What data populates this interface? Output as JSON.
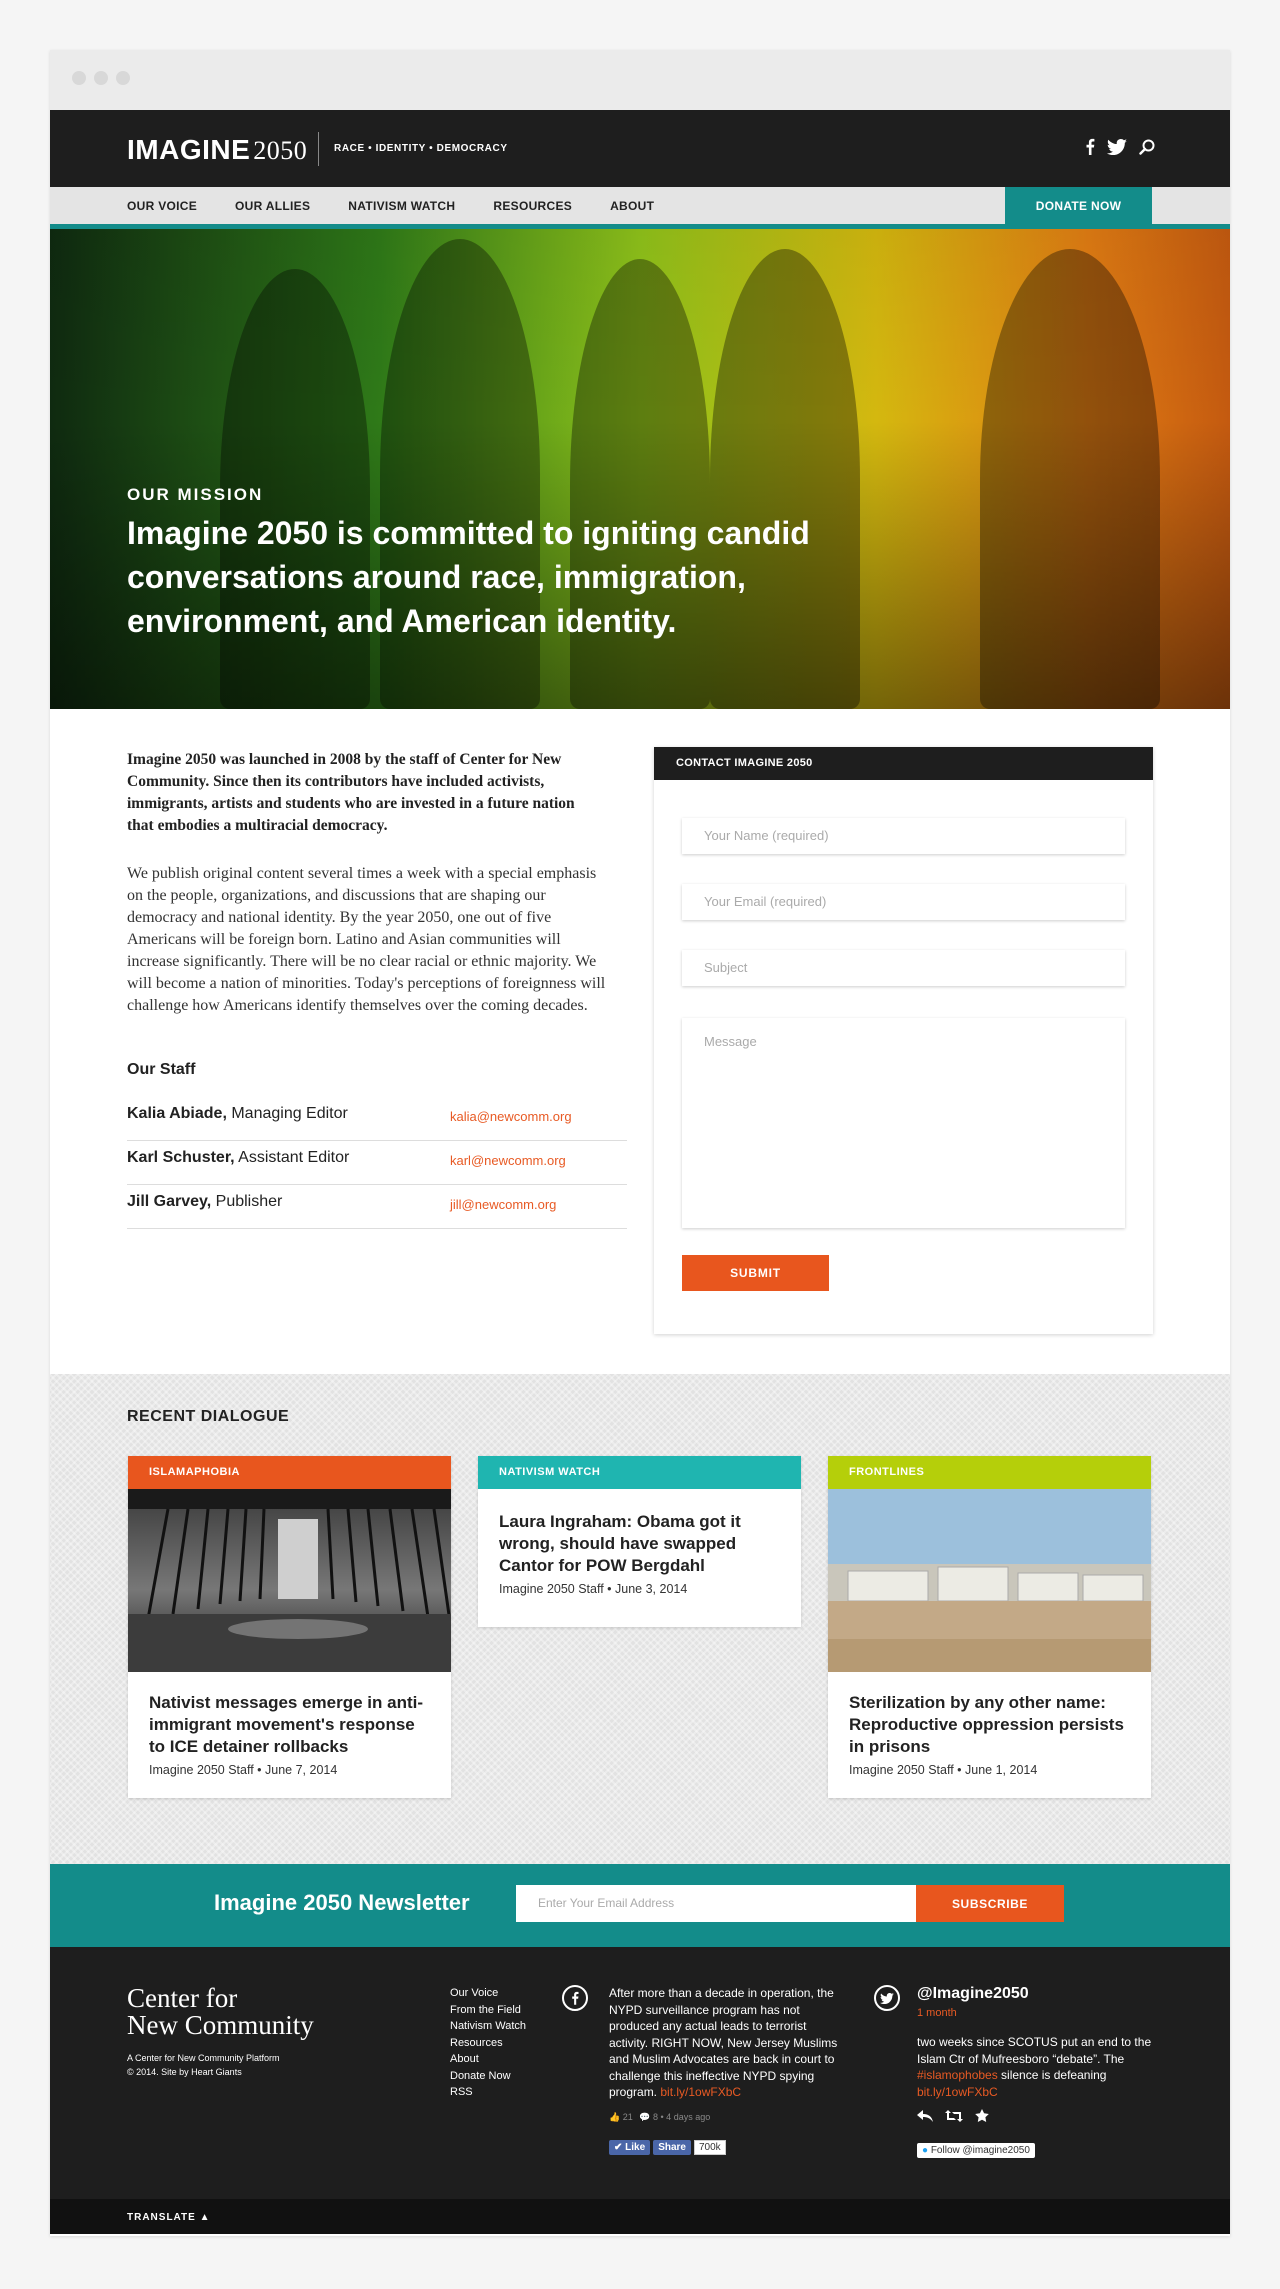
{
  "header": {
    "logo": "IMAGINE",
    "logo_year": "2050",
    "tagline": "RACE • IDENTITY • DEMOCRACY",
    "social_icons": [
      "facebook-icon",
      "twitter-icon",
      "search-icon"
    ]
  },
  "nav": {
    "items": [
      "OUR VOICE",
      "OUR ALLIES",
      "NATIVISM WATCH",
      "RESOURCES",
      "ABOUT"
    ],
    "donate": "DONATE NOW"
  },
  "hero": {
    "label": "OUR MISSION",
    "text": "Imagine 2050 is committed to igniting candid conversations around race, immigration, environment, and American identity."
  },
  "intro": {
    "bold": "Imagine 2050 was launched in 2008 by the staff of Center for New Community. Since then its contributors have included activists, immigrants, artists and students who are invested in a future nation that embodies a multiracial democracy.",
    "body": "We publish original content several times a week with a special emphasis on the people, organizations, and discussions that are shaping our democracy and national identity. By the year 2050, one out of five Americans will be foreign born. Latino and Asian communities will increase significantly. There will be no clear racial or ethnic majority. We will become a nation of minorities. Today's perceptions of foreignness will challenge how Americans identify themselves over the coming decades."
  },
  "staff": {
    "title": "Our Staff",
    "members": [
      {
        "name": "Kalia Abiade,",
        "role": " Managing Editor",
        "email": "kalia@newcomm.org"
      },
      {
        "name": "Karl Schuster,",
        "role": " Assistant Editor",
        "email": "karl@newcomm.org"
      },
      {
        "name": "Jill Garvey,",
        "role": " Publisher",
        "email": "jill@newcomm.org"
      }
    ]
  },
  "contact": {
    "title": "CONTACT IMAGINE 2050",
    "name_placeholder": "Your Name (required)",
    "email_placeholder": "Your Email (required)",
    "subject_placeholder": "Subject",
    "message_placeholder": "Message",
    "submit": "SUBMIT"
  },
  "dialogue": {
    "title": "RECENT DIALOGUE",
    "cards": [
      {
        "category": "ISLAMAPHOBIA",
        "color": "#e8561e",
        "title": "Nativist messages emerge in anti-immigrant movement's response to ICE detainer rollbacks",
        "meta": "Imagine 2050 Staff • June 7, 2014"
      },
      {
        "category": "NATIVISM WATCH",
        "color": "#1fb5b0",
        "title": "Laura Ingraham: Obama got it wrong, should have swapped Cantor for POW Bergdahl",
        "meta": "Imagine 2050 Staff • June 3, 2014"
      },
      {
        "category": "FRONTLINES",
        "color": "#b5cf0a",
        "title": "Sterilization by any other name: Reproductive oppression persists in prisons",
        "meta": "Imagine 2050 Staff • June 1, 2014"
      }
    ]
  },
  "newsletter": {
    "title": "Imagine 2050 Newsletter",
    "placeholder": "Enter Your Email Address",
    "button": "SUBSCRIBE"
  },
  "footer": {
    "org_line1": "Center for",
    "org_line2": "New Community",
    "sub1": "A Center for New Community Platform",
    "sub2": "© 2014. Site by Heart Giants",
    "links": [
      "Our Voice",
      "From the Field",
      "Nativism Watch",
      "Resources",
      "About",
      "Donate Now",
      "RSS"
    ],
    "fb_post": "After more than a decade in operation, the NYPD surveillance program has not produced any actual leads to terrorist activity. RIGHT NOW, New Jersey Muslims and Muslim Advocates are back in court to challenge this ineffective NYPD spying program.",
    "fb_link": "bit.ly/1owFXbC",
    "fb_likes": "21",
    "fb_comments": "8",
    "fb_time": "• 4 days ago",
    "fb_like_btn": "Like",
    "fb_share_btn": "Share",
    "fb_share_count": "700k",
    "tw_handle": "@Imagine2050",
    "tw_time": "1 month",
    "tw_text1": "two weeks since SCOTUS put an end to the Islam Ctr of Mufreesboro “debate”. The ",
    "tw_hashtag": "#islamophobes",
    "tw_text2": " silence is defeaning",
    "tw_link": "bit.ly/1owFXbC",
    "tw_follow": "Follow @imagine2050",
    "translate": "TRANSLATE"
  }
}
